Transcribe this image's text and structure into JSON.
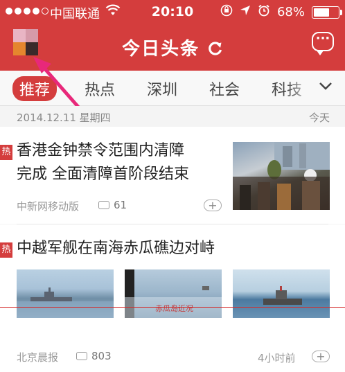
{
  "status_bar": {
    "carrier": "中国联通",
    "time": "20:10",
    "battery": "68%",
    "battery_level": 0.68
  },
  "header": {
    "brand": "今日头条",
    "refresh_icon": "refresh-icon",
    "message_icon": "chat-icon",
    "message_dots": "···",
    "avatar_colors": [
      "#e9b5c4",
      "#d69aa9",
      "#e5862e",
      "#3a2a2a"
    ]
  },
  "tabs": [
    "推荐",
    "热点",
    "深圳",
    "社会",
    "科技"
  ],
  "date_bar": {
    "date": "2014.12.11 星期四",
    "today": "今天"
  },
  "news": [
    {
      "hot": "热",
      "title_line1": "香港金钟禁令范围内清障",
      "title_line2": "完成 全面清障首阶段结束",
      "source": "中新网移动版",
      "comments": "61",
      "plus": "+"
    },
    {
      "hot": "热",
      "title": "中越军舰在南海赤瓜礁边对峙",
      "source": "北京晨报",
      "comments": "803",
      "time": "4小时前",
      "plus": "+",
      "image_caption": "赤瓜岛近况"
    }
  ],
  "colors": {
    "accent": "#d43d3d",
    "arrow": "#e8287a"
  }
}
